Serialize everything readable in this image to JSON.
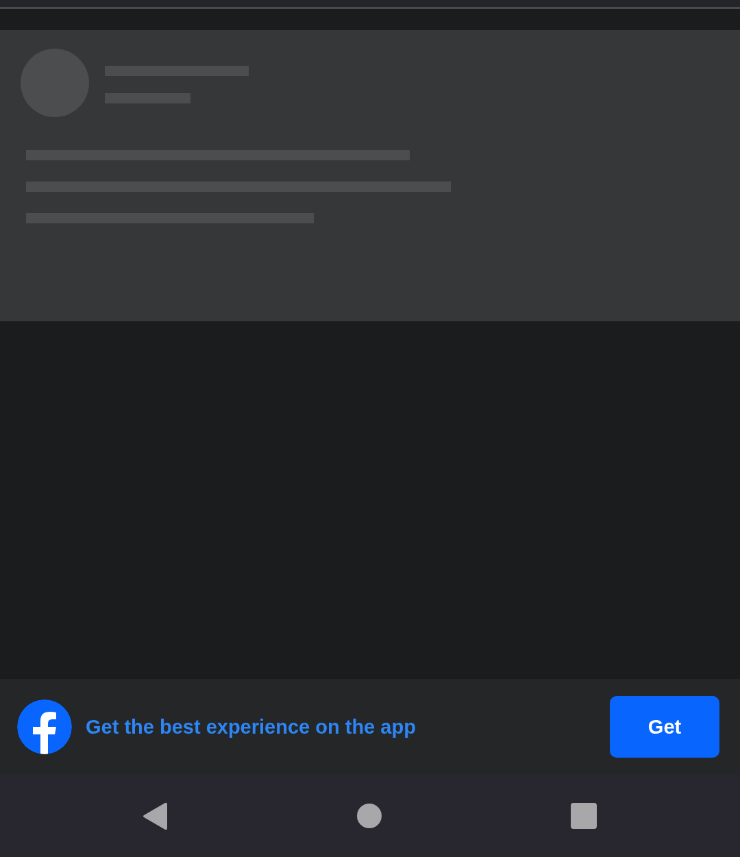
{
  "feed": [
    {
      "kind": "loading-placeholder"
    }
  ],
  "app_banner": {
    "text": "Get the best experience on the app",
    "button": "Get"
  }
}
